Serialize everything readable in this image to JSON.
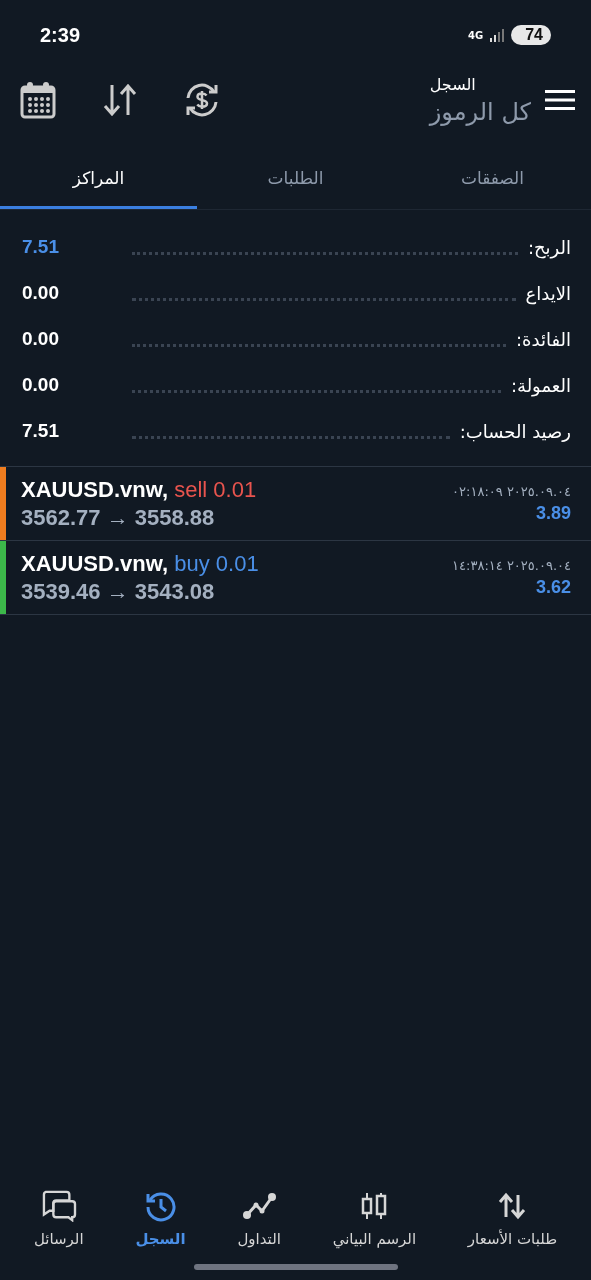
{
  "status_bar": {
    "time": "2:39",
    "network": "4G",
    "battery": "74"
  },
  "header": {
    "title": "السجل",
    "subtitle": "كل الرموز"
  },
  "tabs": [
    {
      "label": "الصفقات",
      "selected": false
    },
    {
      "label": "الطلبات",
      "selected": false
    },
    {
      "label": "المراكز",
      "selected": true
    }
  ],
  "summary": [
    {
      "label": "الربح:",
      "value": "7.51",
      "color": "#4a8fe7"
    },
    {
      "label": "الايداع",
      "value": "0.00",
      "color": "#ffffff"
    },
    {
      "label": "الفائدة:",
      "value": "0.00",
      "color": "#ffffff"
    },
    {
      "label": "العمولة:",
      "value": "0.00",
      "color": "#ffffff"
    },
    {
      "label": "رصيد الحساب:",
      "value": "7.51",
      "color": "#ffffff"
    }
  ],
  "deals": [
    {
      "kind": "sell",
      "symbol": "XAUUSD.vnw,",
      "side": "sell 0.01",
      "prices": "3562.77 → 3558.88",
      "time": "٢٠٢٥.٠٩.٠٤ ٠٢:١٨:٠٩",
      "profit": "3.89"
    },
    {
      "kind": "buy",
      "symbol": "XAUUSD.vnw,",
      "side": "buy 0.01",
      "prices": "3539.46 → 3543.08",
      "time": "٢٠٢٥.٠٩.٠٤ ١٤:٣٨:١٤",
      "profit": "3.62"
    }
  ],
  "bottom_nav": [
    {
      "kind": "quotes",
      "label": "طلبات الأسعار",
      "selected": false
    },
    {
      "kind": "chart",
      "label": "الرسم البياني",
      "selected": false
    },
    {
      "kind": "trade",
      "label": "التداول",
      "selected": false
    },
    {
      "kind": "history",
      "label": "السجل",
      "selected": true
    },
    {
      "kind": "messages",
      "label": "الرسائل",
      "selected": false
    }
  ]
}
